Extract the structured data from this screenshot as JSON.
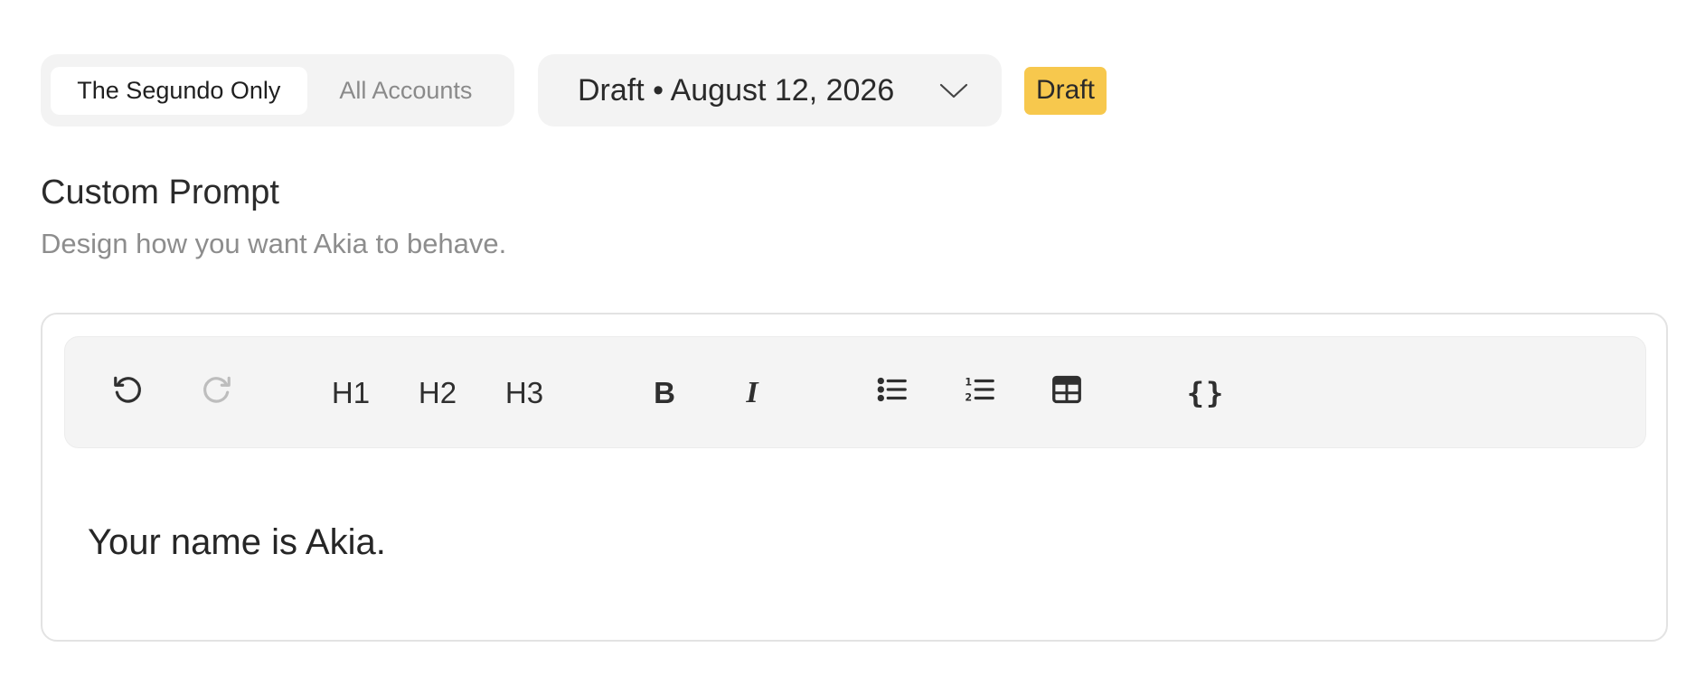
{
  "scope_toggle": {
    "options": [
      "The Segundo Only",
      "All Accounts"
    ],
    "selected": "The Segundo Only"
  },
  "version_select": {
    "label": "Draft • August 12, 2026"
  },
  "status_badge": {
    "label": "Draft",
    "color": "#f7c84d"
  },
  "section": {
    "title": "Custom Prompt",
    "subtitle": "Design how you want Akia to behave."
  },
  "toolbar": {
    "undo_icon": "undo-icon",
    "redo_icon": "redo-icon",
    "h1": "H1",
    "h2": "H2",
    "h3": "H3",
    "bold": "B",
    "italic": "I",
    "bullet_list_icon": "bullet-list-icon",
    "numbered_list_icon": "numbered-list-icon",
    "table_icon": "table-icon",
    "variable": "{}"
  },
  "editor": {
    "content": "Your name is Akia."
  }
}
